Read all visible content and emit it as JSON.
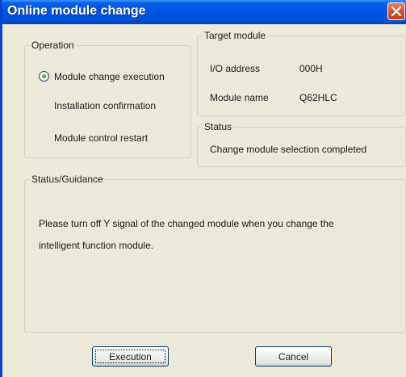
{
  "window": {
    "title": "Online module change"
  },
  "operation": {
    "legend": "Operation",
    "steps": [
      {
        "label": "Module change execution",
        "selected": true
      },
      {
        "label": "Installation confirmation",
        "selected": false
      },
      {
        "label": "Module control restart",
        "selected": false
      }
    ]
  },
  "target_module": {
    "legend": "Target module",
    "io_address_label": "I/O address",
    "io_address_value": "000H",
    "module_name_label": "Module name",
    "module_name_value": "Q62HLC"
  },
  "status": {
    "legend": "Status",
    "text": "Change module selection completed"
  },
  "guidance": {
    "legend": "Status/Guidance",
    "line1": "Please turn off Y signal of the changed module when you change the",
    "line2": "intelligent function module."
  },
  "buttons": {
    "execution": "Execution",
    "cancel": "Cancel"
  },
  "colors": {
    "titlebar": "#0054e3",
    "dialog_bg": "#ece9d8",
    "close_button": "#d8532e"
  }
}
